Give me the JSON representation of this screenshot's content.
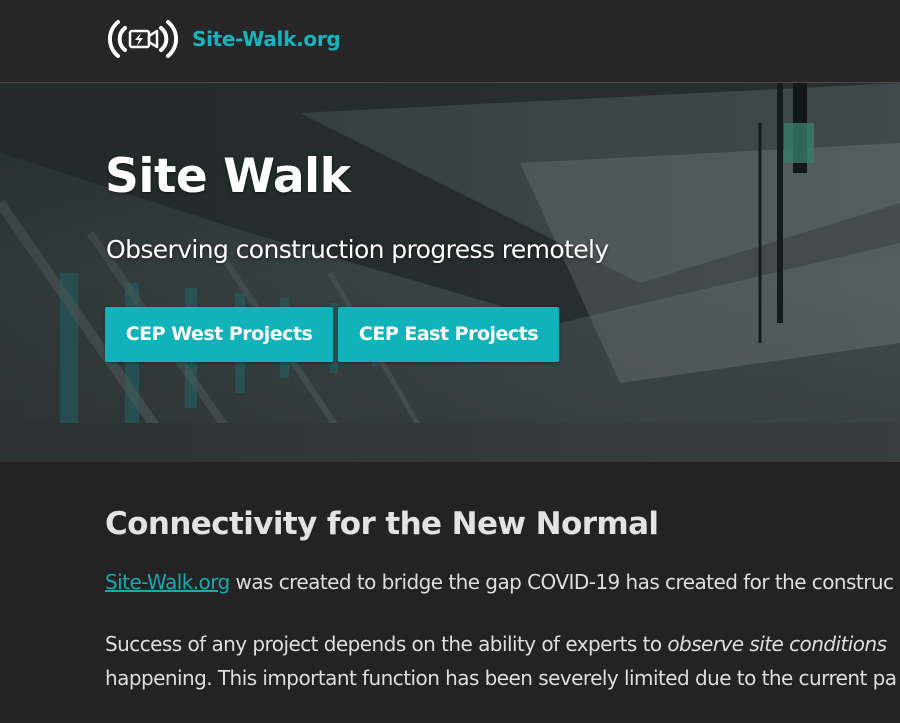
{
  "header": {
    "brand": "Site-Walk.org",
    "logo_icon": "broadcast-camera-icon"
  },
  "hero": {
    "title": "Site Walk",
    "subtitle": "Observing construction progress remotely",
    "buttons": [
      {
        "label": "CEP West Projects"
      },
      {
        "label": "CEP East Projects"
      }
    ]
  },
  "content": {
    "heading": "Connectivity for the New Normal",
    "para1": {
      "link": "Site-Walk.org",
      "text": " was created to bridge the gap COVID-19 has created for the construc"
    },
    "para2": {
      "line1_start": "Success of any project depends on the ability of experts to ",
      "line1_em": "observe site conditions",
      "line2": "happening. This important function has been severely limited due to the current pa"
    }
  },
  "colors": {
    "accent": "#12b2bb",
    "background": "#232323",
    "header_bg": "#262626"
  }
}
